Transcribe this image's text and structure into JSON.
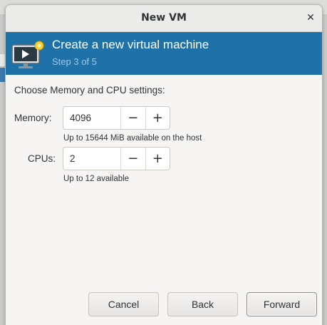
{
  "window": {
    "title": "New VM",
    "close_symbol": "✕"
  },
  "banner": {
    "heading": "Create a new virtual machine",
    "step": "Step 3 of 5",
    "icon": "virtual-machine-new-icon"
  },
  "form": {
    "section_label": "Choose Memory and CPU settings:",
    "memory": {
      "label": "Memory:",
      "value": "4096",
      "hint": "Up to 15644 MiB available on the host"
    },
    "cpus": {
      "label": "CPUs:",
      "value": "2",
      "hint": "Up to 12 available"
    },
    "decrement_symbol": "−",
    "increment_symbol": "+"
  },
  "buttons": {
    "cancel": "Cancel",
    "back": "Back",
    "forward": "Forward"
  },
  "colors": {
    "banner_bg": "#1f72a7",
    "step_text": "#9cc8ee"
  }
}
